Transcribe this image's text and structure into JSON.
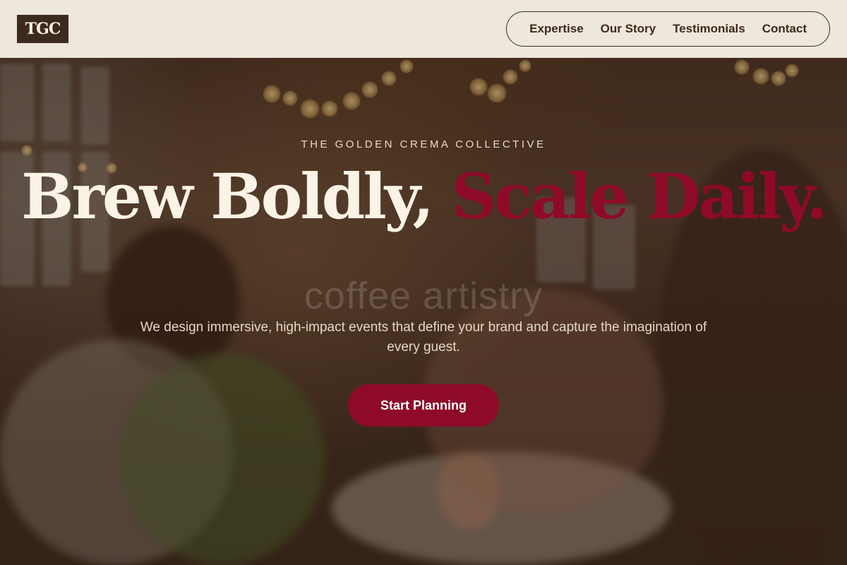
{
  "header": {
    "logo_text": "TGC",
    "nav": [
      {
        "label": "Expertise"
      },
      {
        "label": "Our Story"
      },
      {
        "label": "Testimonials"
      },
      {
        "label": "Contact"
      }
    ]
  },
  "hero": {
    "eyebrow": "THE GOLDEN CREMA COLLECTIVE",
    "headline_part1": "Brew Boldly, ",
    "headline_accent": "Scale Daily.",
    "watermark": "coffee artistry",
    "subcopy": "We design immersive, high-impact events that define your brand and capture the imagination of every guest.",
    "cta_label": "Start Planning"
  },
  "colors": {
    "accent": "#8e0a28",
    "header_bg": "#f4ede2",
    "logo_bg": "#3d2a1e",
    "headline": "#fbf3e6"
  },
  "background_image": "event-toast-dinner-photo"
}
